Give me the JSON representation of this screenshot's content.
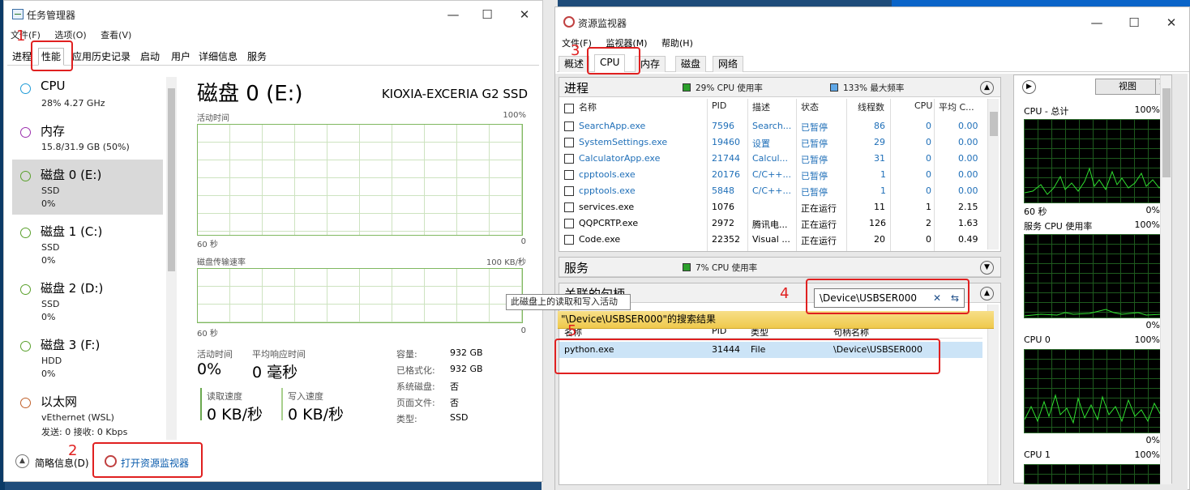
{
  "task_manager": {
    "title": "任务管理器",
    "menu": [
      "文件(F)",
      "选项(O)",
      "查看(V)"
    ],
    "tabs": [
      "进程",
      "性能",
      "应用历史记录",
      "启动",
      "用户",
      "详细信息",
      "服务"
    ],
    "active_tab": "性能",
    "sidebar": [
      {
        "name": "CPU",
        "sub1": "28% 4.27 GHz",
        "sub2": "",
        "color": "#1f9bd7"
      },
      {
        "name": "内存",
        "sub1": "15.8/31.9 GB (50%)",
        "sub2": "",
        "color": "#9b2fae"
      },
      {
        "name": "磁盘 0 (E:)",
        "sub1": "SSD",
        "sub2": "0%",
        "color": "#5aa02c"
      },
      {
        "name": "磁盘 1 (C:)",
        "sub1": "SSD",
        "sub2": "0%",
        "color": "#5aa02c"
      },
      {
        "name": "磁盘 2 (D:)",
        "sub1": "SSD",
        "sub2": "0%",
        "color": "#5aa02c"
      },
      {
        "name": "磁盘 3 (F:)",
        "sub1": "HDD",
        "sub2": "0%",
        "color": "#5aa02c"
      },
      {
        "name": "以太网",
        "sub1": "vEthernet (WSL)",
        "sub2": "发送: 0 接收: 0 Kbps",
        "color": "#c0602a"
      }
    ],
    "disk": {
      "title": "磁盘 0 (E:)",
      "model": "KIOXIA-EXCERIA G2 SSD",
      "g1_label": "活动时间",
      "g1_max": "100%",
      "g1_time": "60 秒",
      "g1_min": "0",
      "g2_label": "磁盘传输速率",
      "g2_max": "100 KB/秒",
      "g2_time": "60 秒",
      "g2_min": "0",
      "active_time_label": "活动时间",
      "active_time_value": "0%",
      "response_label": "平均响应时间",
      "response_value": "0 毫秒",
      "read_label": "读取速度",
      "read_value": "0 KB/秒",
      "write_label": "写入速度",
      "write_value": "0 KB/秒",
      "props": [
        {
          "k": "容量:",
          "v": "932 GB"
        },
        {
          "k": "已格式化:",
          "v": "932 GB"
        },
        {
          "k": "系统磁盘:",
          "v": "否"
        },
        {
          "k": "页面文件:",
          "v": "否"
        },
        {
          "k": "类型:",
          "v": "SSD"
        }
      ]
    },
    "tooltip": "此磁盘上的读取和写入活动",
    "summary": "简略信息(D)",
    "open_resmon": "打开资源监视器"
  },
  "annotations": [
    "1",
    "2",
    "3",
    "4",
    "5"
  ],
  "resource_monitor": {
    "title": "资源监视器",
    "menu": [
      "文件(F)",
      "监视器(M)",
      "帮助(H)"
    ],
    "tabs": [
      "概述",
      "CPU",
      "内存",
      "磁盘",
      "网络"
    ],
    "active_tab": "CPU",
    "processes": {
      "title": "进程",
      "cpu_usage": "29% CPU 使用率",
      "max_freq": "133% 最大频率",
      "columns": [
        "名称",
        "PID",
        "描述",
        "状态",
        "线程数",
        "CPU",
        "平均 C..."
      ],
      "rows": [
        {
          "name": "SearchApp.exe",
          "pid": "7596",
          "desc": "Search...",
          "status": "已暂停",
          "threads": "86",
          "cpu": "0",
          "avg": "0.00",
          "suspended": true
        },
        {
          "name": "SystemSettings.exe",
          "pid": "19460",
          "desc": "设置",
          "status": "已暂停",
          "threads": "29",
          "cpu": "0",
          "avg": "0.00",
          "suspended": true
        },
        {
          "name": "CalculatorApp.exe",
          "pid": "21744",
          "desc": "Calcul...",
          "status": "已暂停",
          "threads": "31",
          "cpu": "0",
          "avg": "0.00",
          "suspended": true
        },
        {
          "name": "cpptools.exe",
          "pid": "20176",
          "desc": "C/C++...",
          "status": "已暂停",
          "threads": "1",
          "cpu": "0",
          "avg": "0.00",
          "suspended": true
        },
        {
          "name": "cpptools.exe",
          "pid": "5848",
          "desc": "C/C++...",
          "status": "已暂停",
          "threads": "1",
          "cpu": "0",
          "avg": "0.00",
          "suspended": true
        },
        {
          "name": "services.exe",
          "pid": "1076",
          "desc": "",
          "status": "正在运行",
          "threads": "11",
          "cpu": "1",
          "avg": "2.15",
          "suspended": false
        },
        {
          "name": "QQPCRTP.exe",
          "pid": "2972",
          "desc": "腾讯电...",
          "status": "正在运行",
          "threads": "126",
          "cpu": "2",
          "avg": "1.63",
          "suspended": false
        },
        {
          "name": "Code.exe",
          "pid": "22352",
          "desc": "Visual ...",
          "status": "正在运行",
          "threads": "20",
          "cpu": "0",
          "avg": "0.49",
          "suspended": false
        }
      ]
    },
    "services": {
      "title": "服务",
      "cpu_usage": "7% CPU 使用率"
    },
    "handles": {
      "title": "关联的句柄",
      "search_value": "\\Device\\USBSER000",
      "result_text": "\"\\Device\\USBSER000\"的搜索结果",
      "columns": [
        "名称",
        "PID",
        "类型",
        "句柄名称"
      ],
      "rows": [
        {
          "name": "python.exe",
          "pid": "31444",
          "type": "File",
          "handle": "\\Device\\USBSER000"
        }
      ]
    },
    "right_panel": {
      "view_label": "视图",
      "graphs": [
        {
          "title": "CPU - 总计",
          "max": "100%",
          "foot_left": "60 秒",
          "foot_right": "0%"
        },
        {
          "title": "服务 CPU 使用率",
          "max": "100%",
          "foot_left": "",
          "foot_right": "0%"
        },
        {
          "title": "CPU 0",
          "max": "100%",
          "foot_left": "",
          "foot_right": "0%"
        },
        {
          "title": "CPU 1",
          "max": "100%",
          "foot_left": "",
          "foot_right": ""
        }
      ]
    }
  }
}
